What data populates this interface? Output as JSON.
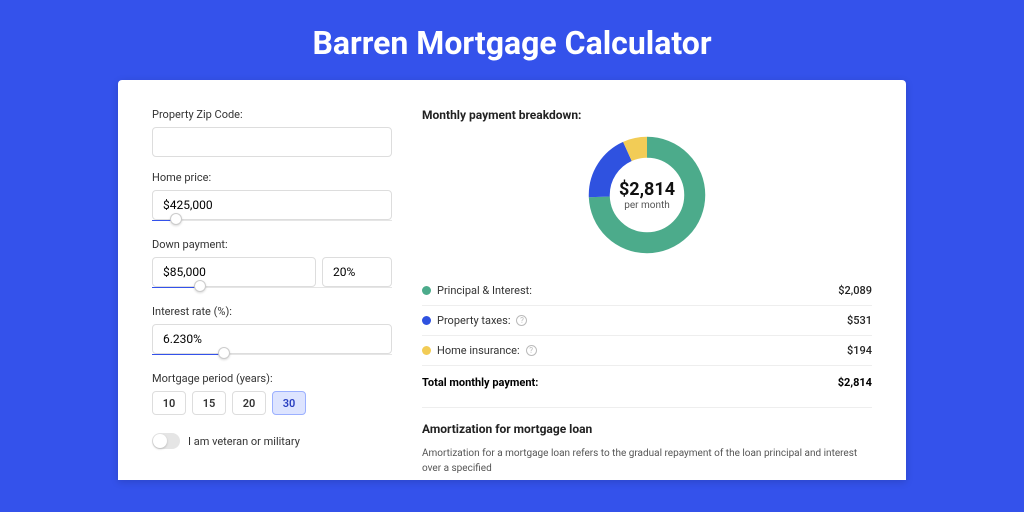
{
  "hero": {
    "title": "Barren Mortgage Calculator"
  },
  "form": {
    "zip_label": "Property Zip Code:",
    "zip_value": "",
    "home_price_label": "Home price:",
    "home_price_value": "$425,000",
    "home_price_slider_pct": 10,
    "down_label": "Down payment:",
    "down_amount": "$85,000",
    "down_pct": "20%",
    "down_slider_pct": 20,
    "rate_label": "Interest rate (%):",
    "rate_value": "6.230%",
    "rate_slider_pct": 30,
    "period_label": "Mortgage period (years):",
    "periods": [
      "10",
      "15",
      "20",
      "30"
    ],
    "period_active_index": 3,
    "veteran_label": "I am veteran or military",
    "veteran_on": false
  },
  "breakdown": {
    "title": "Monthly payment breakdown:",
    "center_amount": "$2,814",
    "center_sub": "per month",
    "rows": [
      {
        "color": "green",
        "label": "Principal & Interest:",
        "has_info": false,
        "value": "$2,089"
      },
      {
        "color": "blue",
        "label": "Property taxes:",
        "has_info": true,
        "value": "$531"
      },
      {
        "color": "yellow",
        "label": "Home insurance:",
        "has_info": true,
        "value": "$194"
      }
    ],
    "total_label": "Total monthly payment:",
    "total_value": "$2,814"
  },
  "chart_data": {
    "type": "pie",
    "title": "Monthly payment breakdown",
    "series": [
      {
        "name": "Principal & Interest",
        "value": 2089,
        "color": "#4cab8b"
      },
      {
        "name": "Property taxes",
        "value": 531,
        "color": "#2f52e0"
      },
      {
        "name": "Home insurance",
        "value": 194,
        "color": "#f2cc56"
      }
    ],
    "total": 2814
  },
  "amort": {
    "title": "Amortization for mortgage loan",
    "text": "Amortization for a mortgage loan refers to the gradual repayment of the loan principal and interest over a specified"
  }
}
